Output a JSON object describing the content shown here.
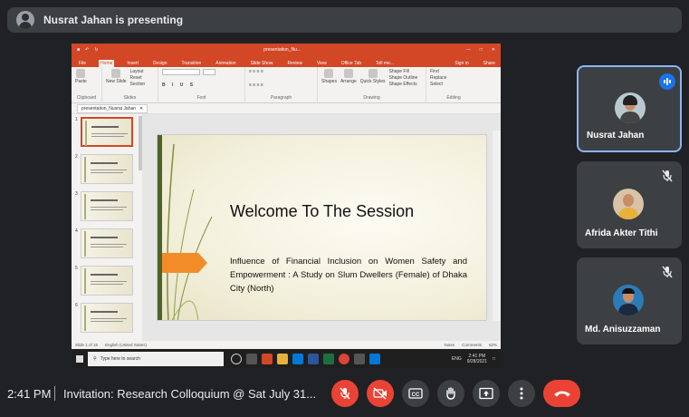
{
  "presenting_banner": {
    "text": "Nusrat Jahan is presenting"
  },
  "shared_screen": {
    "window_title": "presentation_Nu...",
    "ribbon_tabs": [
      "File",
      "Home",
      "Insert",
      "Design",
      "Transition",
      "Animation",
      "Slide Show",
      "Review",
      "View",
      "Office Tab",
      "Tell me..."
    ],
    "active_tab": "Home",
    "user_actions": [
      "Sign in",
      "Share"
    ],
    "ribbon_groups": [
      "Clipboard",
      "Slides",
      "Font",
      "Paragraph",
      "Drawing",
      "Editing"
    ],
    "ribbon_buttons": {
      "paste": "Paste",
      "new_slide": "New Slide",
      "layout": "Layout",
      "reset": "Reset",
      "section": "Section",
      "shapes": "Shapes",
      "arrange": "Arrange",
      "quick_styles": "Quick Styles",
      "shape_fill": "Shape Fill",
      "shape_outline": "Shape Outline",
      "shape_effects": "Shape Effects",
      "find": "Find",
      "replace": "Replace",
      "select": "Select"
    },
    "file_tab": "presentation_Nusrat Jahan",
    "thumbnail_numbers": [
      "1",
      "2",
      "3",
      "4",
      "5",
      "6"
    ],
    "slide": {
      "title": "Welcome To The Session",
      "body": "Influence of Financial Inclusion on Women Safety and Empowerment : A Study on Slum Dwellers (Female) of Dhaka City (North)"
    },
    "status": {
      "slide_of": "Slide 1 of 16",
      "language": "English (United States)",
      "notes": "Notes",
      "comments": "Comments",
      "zoom": "62%"
    },
    "taskbar": {
      "search_placeholder": "Type here to search",
      "time": "2:41 PM",
      "date": "9/28/2021",
      "lang": "ENG"
    }
  },
  "participants": [
    {
      "name": "Nusrat Jahan",
      "speaking": true
    },
    {
      "name": "Afrida Akter Tithi",
      "muted": true
    },
    {
      "name": "Md. Anisuzzaman",
      "muted": true
    }
  ],
  "bottom_bar": {
    "time": "2:41 PM",
    "separator": "|",
    "meeting_title": "Invitation: Research Colloquium @ Sat July 31...",
    "controls": [
      "mic-off-icon",
      "camera-off-icon",
      "captions-icon",
      "raise-hand-icon",
      "present-icon",
      "more-options-icon",
      "hang-up-icon"
    ],
    "colors": {
      "danger": "#ea4335",
      "control": "#3c4043",
      "accent": "#1a73e8"
    }
  }
}
